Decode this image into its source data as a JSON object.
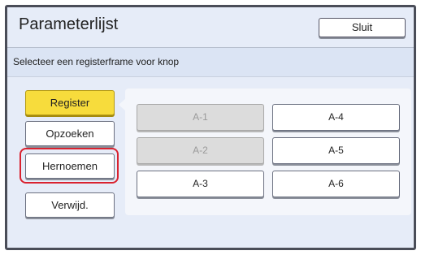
{
  "header": {
    "title": "Parameterlijst",
    "close_label": "Sluit"
  },
  "subheader": {
    "text": "Selecteer een registerframe voor knop"
  },
  "side_buttons": [
    {
      "label": "Register",
      "state": "active"
    },
    {
      "label": "Opzoeken",
      "state": "normal"
    },
    {
      "label": "Hernoemen",
      "state": "highlighted"
    },
    {
      "label": "Verwijd.",
      "state": "normal"
    }
  ],
  "slots": [
    {
      "label": "A-1",
      "enabled": false
    },
    {
      "label": "A-2",
      "enabled": false
    },
    {
      "label": "A-3",
      "enabled": true
    },
    {
      "label": "A-4",
      "enabled": true
    },
    {
      "label": "A-5",
      "enabled": true
    },
    {
      "label": "A-6",
      "enabled": true
    }
  ],
  "colors": {
    "active_button": "#f7dc3c",
    "highlight_ring": "#d9222f",
    "background": "#e6ecf8"
  }
}
